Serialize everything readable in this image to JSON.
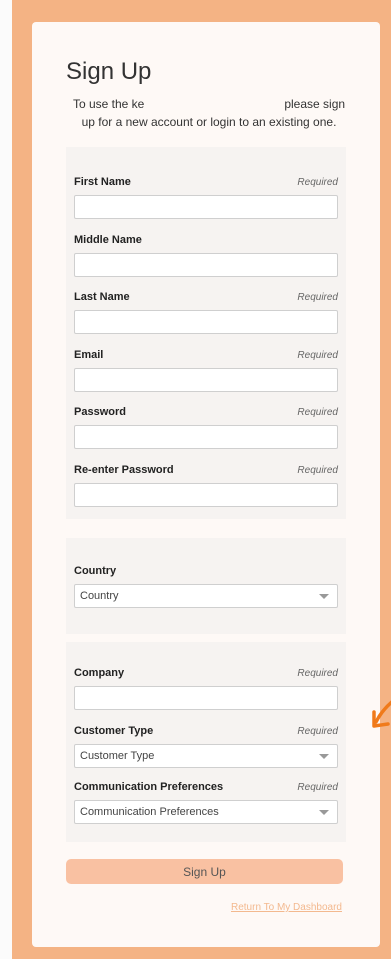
{
  "page_title": "Sign Up",
  "intro": {
    "before": "To use the ke",
    "after": "please sign up for a new account or login to an existing one."
  },
  "account_fields": [
    {
      "label": "First Name",
      "required": "Required"
    },
    {
      "label": "Middle Name",
      "required": ""
    },
    {
      "label": "Last Name",
      "required": "Required"
    },
    {
      "label": "Email",
      "required": "Required"
    },
    {
      "label": "Password",
      "required": "Required"
    },
    {
      "label": "Re-enter Password",
      "required": "Required"
    }
  ],
  "country": {
    "label": "Country",
    "selected": "Country"
  },
  "company": {
    "label": "Company",
    "required": "Required"
  },
  "customer_type": {
    "label": "Customer Type",
    "required": "Required",
    "selected": "Customer Type"
  },
  "communication": {
    "label": "Communication Preferences",
    "required": "Required",
    "selected": "Communication Preferences"
  },
  "signup_button": "Sign Up",
  "return_link": "Return To My Dashboard",
  "colors": {
    "frame": "#f4b384",
    "card": "#fef9f6",
    "button": "#f9c1a2",
    "link": "#f3b98f",
    "arrow": "#f07a1a"
  }
}
